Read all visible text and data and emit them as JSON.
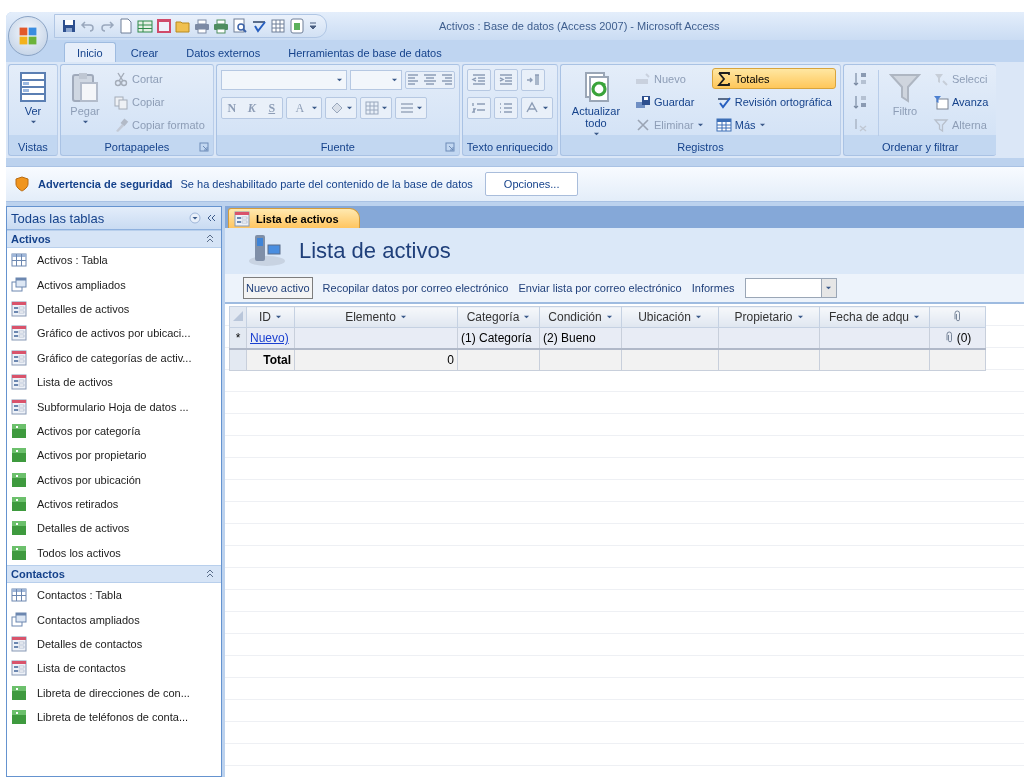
{
  "window": {
    "title": "Activos : Base de datos (Access 2007) - Microsoft Access"
  },
  "ribbon_tabs": [
    {
      "label": "Inicio",
      "selected": true
    },
    {
      "label": "Crear",
      "selected": false
    },
    {
      "label": "Datos externos",
      "selected": false
    },
    {
      "label": "Herramientas de base de datos",
      "selected": false
    }
  ],
  "ribbon_groups": [
    {
      "kind": "views",
      "label": "Vistas",
      "launcher": false,
      "controls": [
        {
          "kind": "large",
          "label": "Ver",
          "dropdown": true,
          "disabled": false,
          "on": false
        }
      ]
    },
    {
      "kind": "clipboard",
      "label": "Portapapeles",
      "launcher": true,
      "controls": [
        {
          "kind": "large",
          "label": "Pegar",
          "dropdown": true,
          "disabled": true,
          "on": false
        },
        {
          "kind": "small",
          "label": "Cortar",
          "dropdown": false,
          "disabled": true,
          "on": false
        },
        {
          "kind": "small",
          "label": "Copiar",
          "dropdown": false,
          "disabled": true,
          "on": false
        },
        {
          "kind": "small",
          "label": "Copiar formato",
          "dropdown": false,
          "disabled": true,
          "on": false
        }
      ]
    },
    {
      "kind": "font",
      "label": "Fuente",
      "launcher": true,
      "letters": [
        {
          "label": "N",
          "disabled": true
        },
        {
          "label": "K",
          "disabled": true
        },
        {
          "label": "S",
          "disabled": true
        },
        {
          "label": "A",
          "disabled": true
        }
      ]
    },
    {
      "kind": "richtext",
      "label": "Texto enriquecido",
      "launcher": false
    },
    {
      "kind": "records",
      "label": "Registros",
      "launcher": false,
      "controls": [
        {
          "kind": "large",
          "label": "Actualizar todo",
          "dropdown": true,
          "disabled": false,
          "on": false
        },
        {
          "kind": "small",
          "label": "Nuevo",
          "dropdown": false,
          "disabled": true,
          "on": false
        },
        {
          "kind": "small",
          "label": "Guardar",
          "dropdown": false,
          "disabled": false,
          "on": false
        },
        {
          "kind": "small",
          "label": "Eliminar",
          "dropdown": true,
          "disabled": true,
          "on": false
        },
        {
          "kind": "small",
          "label": "Totales",
          "dropdown": false,
          "disabled": false,
          "on": true
        },
        {
          "kind": "small",
          "label": "Revisión ortográfica",
          "dropdown": false,
          "disabled": false,
          "on": false
        },
        {
          "kind": "small",
          "label": "Más",
          "dropdown": true,
          "disabled": false,
          "on": false
        }
      ]
    },
    {
      "kind": "sort",
      "label": "Ordenar y filtrar",
      "launcher": false,
      "controls": [
        {
          "kind": "large",
          "label": "Filtro",
          "dropdown": false,
          "disabled": true,
          "on": false
        },
        {
          "kind": "small",
          "label": "Selecci",
          "dropdown": false,
          "disabled": true,
          "on": false
        },
        {
          "kind": "small",
          "label": "Avanza",
          "dropdown": false,
          "disabled": false,
          "on": false
        },
        {
          "kind": "small",
          "label": "Alterna",
          "dropdown": false,
          "disabled": true,
          "on": false
        }
      ]
    }
  ],
  "security_bar": {
    "title": "Advertencia de seguridad",
    "message": "Se ha deshabilitado parte del contenido de la base de datos",
    "button": "Opciones..."
  },
  "navigation_pane": {
    "title": "Todas las tablas",
    "groups": [
      {
        "label": "Activos",
        "expanded": true,
        "items": [
          {
            "kind": "table",
            "label": "Activos : Tabla"
          },
          {
            "kind": "query",
            "label": "Activos ampliados"
          },
          {
            "kind": "form",
            "label": "Detalles de activos"
          },
          {
            "kind": "form",
            "label": "Gráfico de activos por ubicaci..."
          },
          {
            "kind": "form",
            "label": "Gráfico de categorías de activ..."
          },
          {
            "kind": "form",
            "label": "Lista de activos"
          },
          {
            "kind": "form",
            "label": "Subformulario Hoja de datos ..."
          },
          {
            "kind": "report",
            "label": "Activos por categoría"
          },
          {
            "kind": "report",
            "label": "Activos por propietario"
          },
          {
            "kind": "report",
            "label": "Activos por ubicación"
          },
          {
            "kind": "report",
            "label": "Activos retirados"
          },
          {
            "kind": "report",
            "label": "Detalles de activos"
          },
          {
            "kind": "report",
            "label": "Todos los activos"
          }
        ]
      },
      {
        "label": "Contactos",
        "expanded": true,
        "items": [
          {
            "kind": "table",
            "label": "Contactos : Tabla"
          },
          {
            "kind": "query",
            "label": "Contactos ampliados"
          },
          {
            "kind": "form",
            "label": "Detalles de contactos"
          },
          {
            "kind": "form",
            "label": "Lista de contactos"
          },
          {
            "kind": "report",
            "label": "Libreta de direcciones de con..."
          },
          {
            "kind": "report",
            "label": "Libreta de teléfonos de conta..."
          }
        ]
      }
    ]
  },
  "document_tabs": [
    {
      "label": "Lista de activos",
      "selected": true
    }
  ],
  "form": {
    "title": "Lista de activos",
    "actions": [
      {
        "kind": "button",
        "label": "Nuevo activo"
      },
      {
        "kind": "link",
        "label": "Recopilar datos por correo electrónico"
      },
      {
        "kind": "link",
        "label": "Enviar lista por correo electrónico"
      },
      {
        "kind": "link",
        "label": "Informes"
      },
      {
        "kind": "combo"
      }
    ],
    "datasheet": {
      "columns": [
        {
          "kind": "text",
          "label": "ID"
        },
        {
          "kind": "text",
          "label": "Elemento"
        },
        {
          "kind": "text",
          "label": "Categoría"
        },
        {
          "kind": "text",
          "label": "Condición"
        },
        {
          "kind": "text",
          "label": "Ubicación"
        },
        {
          "kind": "text",
          "label": "Propietario"
        },
        {
          "kind": "text",
          "label": "Fecha de adqu"
        },
        {
          "kind": "attachment"
        }
      ],
      "rows": [
        {
          "kind": "new",
          "selector": "*",
          "cells": [
            "Nuevo)",
            null,
            "(1) Categoría",
            "(2) Bueno",
            null,
            null,
            null,
            "(0)"
          ]
        },
        {
          "kind": "total",
          "cells": [
            "Total",
            "0",
            null,
            null,
            null,
            null,
            null,
            null
          ]
        }
      ]
    }
  }
}
